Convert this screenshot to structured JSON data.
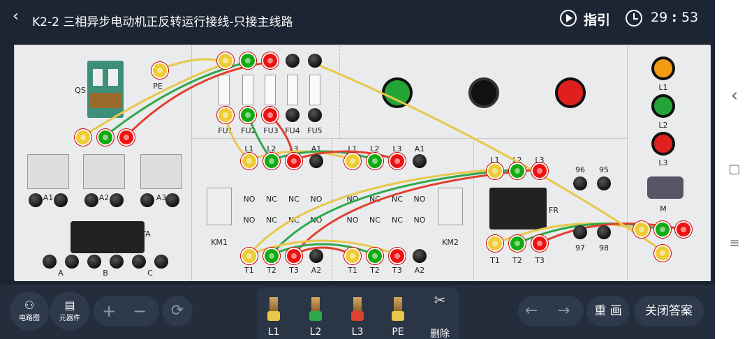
{
  "header": {
    "title": "K2-2 三相异步电动机正反转运行接线-只接主线路",
    "guide_label": "指引",
    "timer_minutes": "29",
    "timer_seconds": "53",
    "timer_sep": ":"
  },
  "board": {
    "qs_label": "QS",
    "pe_label": "PE",
    "fuse_labels": [
      "FU1",
      "FU2",
      "FU3",
      "FU4",
      "FU5"
    ],
    "meter_labels": [
      "A1",
      "A2",
      "A3"
    ],
    "ta_label": "TA",
    "phase_labels": [
      "A",
      "B",
      "C"
    ],
    "km1": {
      "label": "KM1",
      "top": [
        "L1",
        "L2",
        "L3",
        "A1"
      ],
      "row1": [
        "NO",
        "NC",
        "NC",
        "NO"
      ],
      "row2": [
        "NO",
        "NC",
        "NC",
        "NO"
      ],
      "bottom": [
        "T1",
        "T2",
        "T3",
        "A2"
      ]
    },
    "km2": {
      "label": "KM2",
      "top": [
        "L1",
        "L2",
        "L3",
        "A1"
      ],
      "row1": [
        "NO",
        "NC",
        "NC",
        "NO"
      ],
      "row2": [
        "NO",
        "NC",
        "NC",
        "NO"
      ],
      "bottom": [
        "T1",
        "T2",
        "T3",
        "A2"
      ]
    },
    "fr": {
      "label": "FR",
      "top": [
        "L1",
        "L2",
        "L3"
      ],
      "aux_top": [
        "96",
        "95"
      ],
      "aux_bottom": [
        "97",
        "98"
      ],
      "bottom": [
        "T1",
        "T2",
        "T3"
      ]
    },
    "lamps": [
      "L1",
      "L2",
      "L3"
    ],
    "motor_label": "M",
    "lamp_colors": [
      "#f39c12",
      "#22a536",
      "#e0201e"
    ],
    "button_colors": [
      "#22a536",
      "#111111",
      "#e0201e"
    ]
  },
  "bottombar": {
    "circuit_label": "电路图",
    "components_label": "元器件",
    "zoom_in": "+",
    "zoom_out": "−",
    "refresh": "⟳",
    "wires": [
      {
        "label": "L1",
        "color": "#e8c84a"
      },
      {
        "label": "L2",
        "color": "#2ea84a"
      },
      {
        "label": "L3",
        "color": "#e0402e"
      },
      {
        "label": "PE",
        "color": "#e8c84a"
      }
    ],
    "delete_label": "删除",
    "back_arrow": "←",
    "forward_arrow": "→",
    "redraw_label": "重 画",
    "close_answer_label": "关闭答案"
  },
  "sysbar": {
    "back": "‹",
    "home": "▢",
    "menu": "≡"
  }
}
